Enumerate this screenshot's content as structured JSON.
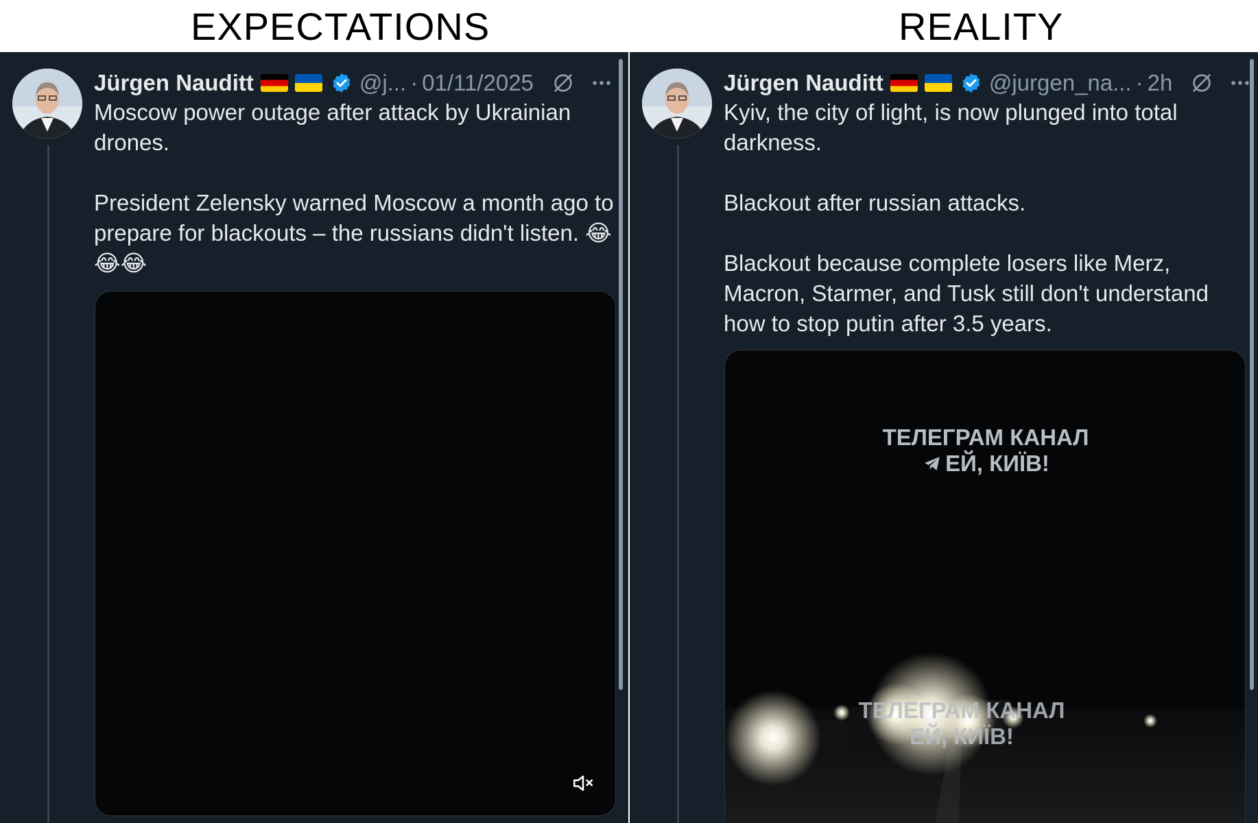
{
  "meme": {
    "left_title": "EXPECTATIONS",
    "right_title": "REALITY"
  },
  "left_post": {
    "author_name": "Jürgen Nauditt",
    "handle": "@j...",
    "separator": "·",
    "timestamp": "01/11/2025",
    "text_paragraphs": [
      "Moscow power outage after attack by Ukrainian drones.",
      "President Zelensky warned Moscow a month ago to prepare for blackouts – the russians didn't listen. 😂😂😂"
    ],
    "media": {
      "type": "video",
      "muted": true
    }
  },
  "right_post": {
    "author_name": "Jürgen Nauditt",
    "handle": "@jurgen_na...",
    "separator": "·",
    "timestamp": "2h",
    "text_paragraphs": [
      "Kyiv, the city of light, is now plunged into total darkness.",
      "Blackout after russian attacks.",
      "Blackout because complete losers like Merz, Macron, Starmer, and Tusk still don't understand how to stop putin after 3.5 years."
    ],
    "media": {
      "type": "video",
      "watermark_top_line1": "ТЕЛЕГРАМ КАНАЛ",
      "watermark_top_line2": "ЕЙ, КИЇВ!",
      "watermark_bottom_line1": "ТЕЛЕГРАМ КАНАЛ",
      "watermark_bottom_line2": "ЕЙ, КИЇВ!"
    }
  },
  "icons": [
    "verified-badge-icon",
    "grok-icon",
    "more-options-icon",
    "mute-icon",
    "telegram-icon",
    "germany-flag-icon",
    "ukraine-flag-icon"
  ],
  "colors": {
    "panel_bg": "#15202b",
    "text_primary": "#e7e9ea",
    "text_secondary": "#8b98a5",
    "verified_blue": "#1d9bf0"
  }
}
